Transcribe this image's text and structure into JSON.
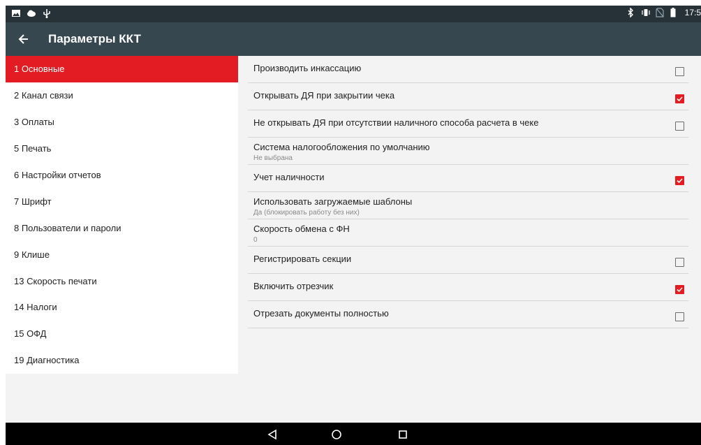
{
  "status_bar": {
    "time": "17:5",
    "icons": [
      "image-icon",
      "cloud-icon",
      "usb-icon",
      "bluetooth-icon",
      "vibrate-icon",
      "no-sim-icon",
      "battery-icon"
    ]
  },
  "app_bar": {
    "title": "Параметры ККТ",
    "back_icon": "arrow-left-icon"
  },
  "menu": {
    "items": [
      {
        "label": "1 Основные",
        "active": true
      },
      {
        "label": "2 Канал связи"
      },
      {
        "label": "3 Оплаты"
      },
      {
        "label": "5 Печать"
      },
      {
        "label": "6 Настройки отчетов"
      },
      {
        "label": "7 Шрифт"
      },
      {
        "label": "8 Пользователи и пароли"
      },
      {
        "label": "9 Клише"
      },
      {
        "label": "13 Скорость печати"
      },
      {
        "label": "14 Налоги"
      },
      {
        "label": "15 ОФД"
      },
      {
        "label": "19 Диагностика"
      }
    ]
  },
  "settings": {
    "rows": [
      {
        "title": "Производить инкассацию",
        "checked": false
      },
      {
        "title": "Открывать ДЯ при закрытии чека",
        "checked": true
      },
      {
        "title": "Не открывать ДЯ при отсутствии наличного способа расчета в чеке",
        "checked": false
      },
      {
        "title": "Система налогообложения по умолчанию",
        "subtitle": "Не выбрана"
      },
      {
        "title": "Учет наличности",
        "checked": true
      },
      {
        "title": "Использовать загружаемые шаблоны",
        "subtitle": "Да (блокировать работу без них)"
      },
      {
        "title": "Скорость обмена с ФН",
        "subtitle": "0"
      },
      {
        "title": "Регистрировать секции",
        "checked": false
      },
      {
        "title": "Включить отрезчик",
        "checked": true
      },
      {
        "title": "Отрезать документы полностью",
        "checked": false
      }
    ]
  },
  "nav_bar": {
    "icons": [
      "back-triangle-icon",
      "home-circle-icon",
      "recents-square-icon"
    ]
  },
  "colors": {
    "accent": "#e31b23",
    "app_bar": "#37474f",
    "status_bar": "#263238"
  }
}
